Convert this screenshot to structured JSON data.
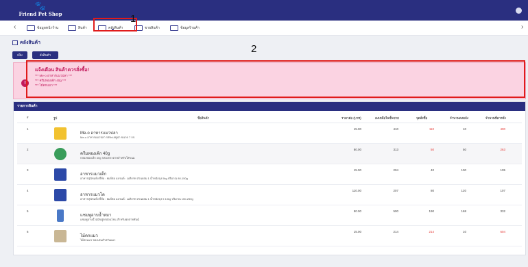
{
  "app": {
    "logo_text": "Friend Pet Shop"
  },
  "nav": {
    "items": [
      {
        "label": "ข้อมูลหน้าร้าน"
      },
      {
        "label": "สินค้า"
      },
      {
        "label": "คลังสินค้า"
      },
      {
        "label": "ขายสินค้า"
      },
      {
        "label": "ข้อมูลร้านค้า"
      }
    ]
  },
  "page": {
    "title": "คลังสินค้า"
  },
  "buttons": {
    "add": "เพิ่ม",
    "order": "สั่งสินค้า"
  },
  "markers": {
    "one": "1",
    "two": "2"
  },
  "alert": {
    "title": "แจ้งเตือน สินค้าควรสั่งซื้อ!",
    "lines": [
      "*** Me-o อาหารแมวปลา ***",
      "*** ครีมทองเค้ก 40g ***",
      "*** ไม้ตกแมว ***"
    ]
  },
  "table": {
    "panel_title": "รายการสินค้า",
    "headers": [
      "#",
      "รูป",
      "ชื่อสินค้า",
      "ราคาต่อ (บาท)",
      "คงเหลือในชั้นขาย",
      "จุดสั่งซื้อ",
      "จำนวนคงคลัง",
      "จำนวนที่ควรสั่ง"
    ],
    "rows": [
      {
        "no": "1",
        "name": "Me-o อาหารแมวปลา",
        "desc": "Me-o อาหารแมวปลา รสทะเลทูน่า ขนาด 7 กก.",
        "price": "15.00",
        "shelf": "410",
        "reorder": "110",
        "stock": "10",
        "toorder": "400",
        "thumb_color": "#f2c230"
      },
      {
        "no": "2",
        "name": "ครีมทองเค้ก 40g",
        "desc": "กล่องทองเค้ก 40g กล่องกระดาษสำหรับใส่ขนม",
        "price": "80.00",
        "shelf": "313",
        "reorder": "50",
        "stock": "50",
        "toorder": "263",
        "thumb_color": "#3a9d5b"
      },
      {
        "no": "3",
        "name": "อาหารแมวเด็ก",
        "desc": "อาหารสุนัขแห้ง ยี่ห้อ : ยมจ์ต่อ แบรนด์ : เมลิกรท ส่วนผสม 1 น้ำหนักถุง 5kg ปริมาณ 80-150g",
        "price": "15.00",
        "shelf": "204",
        "reorder": "40",
        "stock": "100",
        "toorder": "105",
        "thumb_color": "#2c49a8"
      },
      {
        "no": "4",
        "name": "อาหารแมวโต",
        "desc": "อาหารสุนัขแห้ง ยี่ห้อ : ยมจ์ต่อ แบรนด์ : เมลิกรท ส่วนผสม 1 น้ำหนักถุง 5 10kg ปริมาณ 150-250g",
        "price": "110.00",
        "shelf": "207",
        "reorder": "80",
        "stock": "120",
        "toorder": "107",
        "thumb_color": "#2c49a8"
      },
      {
        "no": "5",
        "name": "แชมพูอาบน้ำหมา",
        "desc": "แชมพูอาบน้ำสุนัขสูตรอ่อนโยน สำหรับทุกสายพันธุ์",
        "price": "50.00",
        "shelf": "500",
        "reorder": "190",
        "stock": "168",
        "toorder": "332",
        "thumb_color": "#4a79c7"
      },
      {
        "no": "6",
        "name": "ไม้ตกแมว",
        "desc": "ไม้ตกแมว ของเล่นสำหรับแมว",
        "price": "15.00",
        "shelf": "214",
        "reorder": "214",
        "stock": "10",
        "toorder": "604",
        "thumb_color": "#c9b795"
      }
    ]
  },
  "icons": {
    "logo": "paw-icon",
    "user": "user-avatar-icon",
    "alert": "alert-icon"
  },
  "colors": {
    "brand": "#2a2f80",
    "alert_bg": "#fbd3e2",
    "alert_text": "#c2185b",
    "danger": "#e53935",
    "highlight": "#e01b1b"
  }
}
